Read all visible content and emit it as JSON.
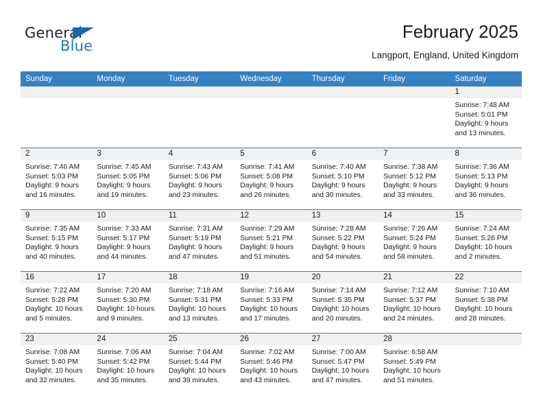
{
  "brand": {
    "name_top": "General",
    "name_bottom": "Blue",
    "accent_color": "#1668b3",
    "blue_text_color": "#2277c8"
  },
  "header": {
    "title": "February 2025",
    "subtitle": "Langport, England, United Kingdom"
  },
  "theme": {
    "header_row_bg": "#3580c3",
    "daynum_band_bg": "#f0f0f0",
    "grid_line": "#3580c3",
    "text": "#1a1a1a"
  },
  "weekdays": [
    "Sunday",
    "Monday",
    "Tuesday",
    "Wednesday",
    "Thursday",
    "Friday",
    "Saturday"
  ],
  "labels": {
    "sunrise_prefix": "Sunrise:",
    "sunset_prefix": "Sunset:",
    "daylight_prefix": "Daylight:"
  },
  "weeks": [
    [
      {
        "day": "",
        "empty": true
      },
      {
        "day": "",
        "empty": true
      },
      {
        "day": "",
        "empty": true
      },
      {
        "day": "",
        "empty": true
      },
      {
        "day": "",
        "empty": true
      },
      {
        "day": "",
        "empty": true
      },
      {
        "day": "1",
        "sunrise": "Sunrise: 7:48 AM",
        "sunset": "Sunset: 5:01 PM",
        "daylight_1": "Daylight: 9 hours",
        "daylight_2": "and 13 minutes."
      }
    ],
    [
      {
        "day": "2",
        "sunrise": "Sunrise: 7:46 AM",
        "sunset": "Sunset: 5:03 PM",
        "daylight_1": "Daylight: 9 hours",
        "daylight_2": "and 16 minutes."
      },
      {
        "day": "3",
        "sunrise": "Sunrise: 7:45 AM",
        "sunset": "Sunset: 5:05 PM",
        "daylight_1": "Daylight: 9 hours",
        "daylight_2": "and 19 minutes."
      },
      {
        "day": "4",
        "sunrise": "Sunrise: 7:43 AM",
        "sunset": "Sunset: 5:06 PM",
        "daylight_1": "Daylight: 9 hours",
        "daylight_2": "and 23 minutes."
      },
      {
        "day": "5",
        "sunrise": "Sunrise: 7:41 AM",
        "sunset": "Sunset: 5:08 PM",
        "daylight_1": "Daylight: 9 hours",
        "daylight_2": "and 26 minutes."
      },
      {
        "day": "6",
        "sunrise": "Sunrise: 7:40 AM",
        "sunset": "Sunset: 5:10 PM",
        "daylight_1": "Daylight: 9 hours",
        "daylight_2": "and 30 minutes."
      },
      {
        "day": "7",
        "sunrise": "Sunrise: 7:38 AM",
        "sunset": "Sunset: 5:12 PM",
        "daylight_1": "Daylight: 9 hours",
        "daylight_2": "and 33 minutes."
      },
      {
        "day": "8",
        "sunrise": "Sunrise: 7:36 AM",
        "sunset": "Sunset: 5:13 PM",
        "daylight_1": "Daylight: 9 hours",
        "daylight_2": "and 36 minutes."
      }
    ],
    [
      {
        "day": "9",
        "sunrise": "Sunrise: 7:35 AM",
        "sunset": "Sunset: 5:15 PM",
        "daylight_1": "Daylight: 9 hours",
        "daylight_2": "and 40 minutes."
      },
      {
        "day": "10",
        "sunrise": "Sunrise: 7:33 AM",
        "sunset": "Sunset: 5:17 PM",
        "daylight_1": "Daylight: 9 hours",
        "daylight_2": "and 44 minutes."
      },
      {
        "day": "11",
        "sunrise": "Sunrise: 7:31 AM",
        "sunset": "Sunset: 5:19 PM",
        "daylight_1": "Daylight: 9 hours",
        "daylight_2": "and 47 minutes."
      },
      {
        "day": "12",
        "sunrise": "Sunrise: 7:29 AM",
        "sunset": "Sunset: 5:21 PM",
        "daylight_1": "Daylight: 9 hours",
        "daylight_2": "and 51 minutes."
      },
      {
        "day": "13",
        "sunrise": "Sunrise: 7:28 AM",
        "sunset": "Sunset: 5:22 PM",
        "daylight_1": "Daylight: 9 hours",
        "daylight_2": "and 54 minutes."
      },
      {
        "day": "14",
        "sunrise": "Sunrise: 7:26 AM",
        "sunset": "Sunset: 5:24 PM",
        "daylight_1": "Daylight: 9 hours",
        "daylight_2": "and 58 minutes."
      },
      {
        "day": "15",
        "sunrise": "Sunrise: 7:24 AM",
        "sunset": "Sunset: 5:26 PM",
        "daylight_1": "Daylight: 10 hours",
        "daylight_2": "and 2 minutes."
      }
    ],
    [
      {
        "day": "16",
        "sunrise": "Sunrise: 7:22 AM",
        "sunset": "Sunset: 5:28 PM",
        "daylight_1": "Daylight: 10 hours",
        "daylight_2": "and 5 minutes."
      },
      {
        "day": "17",
        "sunrise": "Sunrise: 7:20 AM",
        "sunset": "Sunset: 5:30 PM",
        "daylight_1": "Daylight: 10 hours",
        "daylight_2": "and 9 minutes."
      },
      {
        "day": "18",
        "sunrise": "Sunrise: 7:18 AM",
        "sunset": "Sunset: 5:31 PM",
        "daylight_1": "Daylight: 10 hours",
        "daylight_2": "and 13 minutes."
      },
      {
        "day": "19",
        "sunrise": "Sunrise: 7:16 AM",
        "sunset": "Sunset: 5:33 PM",
        "daylight_1": "Daylight: 10 hours",
        "daylight_2": "and 17 minutes."
      },
      {
        "day": "20",
        "sunrise": "Sunrise: 7:14 AM",
        "sunset": "Sunset: 5:35 PM",
        "daylight_1": "Daylight: 10 hours",
        "daylight_2": "and 20 minutes."
      },
      {
        "day": "21",
        "sunrise": "Sunrise: 7:12 AM",
        "sunset": "Sunset: 5:37 PM",
        "daylight_1": "Daylight: 10 hours",
        "daylight_2": "and 24 minutes."
      },
      {
        "day": "22",
        "sunrise": "Sunrise: 7:10 AM",
        "sunset": "Sunset: 5:38 PM",
        "daylight_1": "Daylight: 10 hours",
        "daylight_2": "and 28 minutes."
      }
    ],
    [
      {
        "day": "23",
        "sunrise": "Sunrise: 7:08 AM",
        "sunset": "Sunset: 5:40 PM",
        "daylight_1": "Daylight: 10 hours",
        "daylight_2": "and 32 minutes."
      },
      {
        "day": "24",
        "sunrise": "Sunrise: 7:06 AM",
        "sunset": "Sunset: 5:42 PM",
        "daylight_1": "Daylight: 10 hours",
        "daylight_2": "and 35 minutes."
      },
      {
        "day": "25",
        "sunrise": "Sunrise: 7:04 AM",
        "sunset": "Sunset: 5:44 PM",
        "daylight_1": "Daylight: 10 hours",
        "daylight_2": "and 39 minutes."
      },
      {
        "day": "26",
        "sunrise": "Sunrise: 7:02 AM",
        "sunset": "Sunset: 5:46 PM",
        "daylight_1": "Daylight: 10 hours",
        "daylight_2": "and 43 minutes."
      },
      {
        "day": "27",
        "sunrise": "Sunrise: 7:00 AM",
        "sunset": "Sunset: 5:47 PM",
        "daylight_1": "Daylight: 10 hours",
        "daylight_2": "and 47 minutes."
      },
      {
        "day": "28",
        "sunrise": "Sunrise: 6:58 AM",
        "sunset": "Sunset: 5:49 PM",
        "daylight_1": "Daylight: 10 hours",
        "daylight_2": "and 51 minutes."
      },
      {
        "day": "",
        "empty": true
      }
    ]
  ]
}
